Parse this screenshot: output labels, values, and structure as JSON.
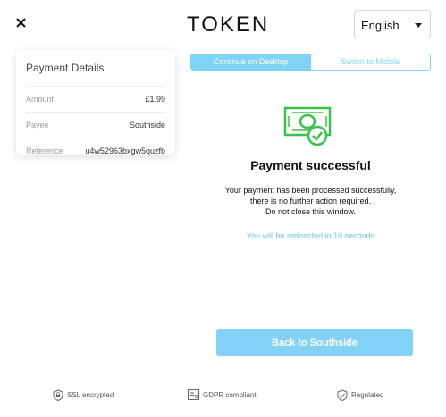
{
  "header": {
    "logo": "TOKEN",
    "language": "English"
  },
  "payment_details": {
    "title": "Payment Details",
    "rows": [
      {
        "label": "Amount",
        "value": "£1.99"
      },
      {
        "label": "Payee",
        "value": "Southside"
      },
      {
        "label": "Reference",
        "value": "u4w52963bxgw5quzfb"
      }
    ]
  },
  "toggle": {
    "desktop": "Continue on Desktop",
    "mobile": "Switch to Mobile"
  },
  "status": {
    "title": "Payment successful",
    "lines": [
      "Your payment has been processed successfully,",
      "there is no further action required.",
      "Do not close this window."
    ],
    "redirect": "You will be redirected in 10 seconds"
  },
  "back_button": "Back to Southside",
  "footer": {
    "ssl": "SSL encrypted",
    "gdpr": "GDPR compliant",
    "regulated": "Regulated"
  },
  "colors": {
    "accent": "#7fd3f6",
    "success": "#3cc24a"
  }
}
